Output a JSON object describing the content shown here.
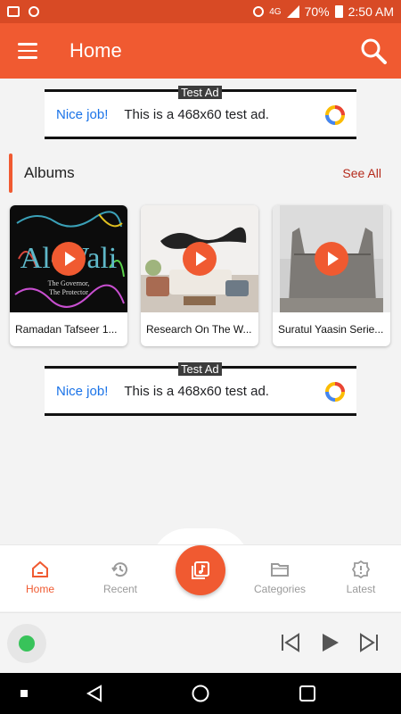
{
  "status_bar": {
    "battery": "70%",
    "time": "2:50 AM",
    "network": "4G"
  },
  "app_bar": {
    "title": "Home"
  },
  "ads": [
    {
      "badge": "Test Ad",
      "nice": "Nice job!",
      "text": "This is a 468x60 test ad."
    },
    {
      "badge": "Test Ad",
      "nice": "Nice job!",
      "text": "This is a 468x60 test ad."
    }
  ],
  "albums": {
    "title": "Albums",
    "see_all": "See All",
    "items": [
      {
        "title": "Ramadan Tafseer 1...",
        "art": "al-wali-calligraphy",
        "art_text": "Al-Wali",
        "art_sub1": "The Governor,",
        "art_sub2": "The Protector"
      },
      {
        "title": "Research On The W...",
        "art": "room-with-calligraphy"
      },
      {
        "title": "Suratul Yaasin Serie...",
        "art": "mud-mosque-photo"
      }
    ]
  },
  "bottom_nav": {
    "items": [
      {
        "label": "Home",
        "icon": "home-icon",
        "active": true
      },
      {
        "label": "Recent",
        "icon": "history-icon",
        "active": false
      },
      {
        "label": "Categories",
        "icon": "folder-icon",
        "active": false
      },
      {
        "label": "Latest",
        "icon": "latest-icon",
        "active": false
      }
    ],
    "fab_icon": "playlist-icon"
  },
  "colors": {
    "accent": "#f05a31",
    "status": "#d84a25",
    "see_all": "#b52b1c"
  }
}
